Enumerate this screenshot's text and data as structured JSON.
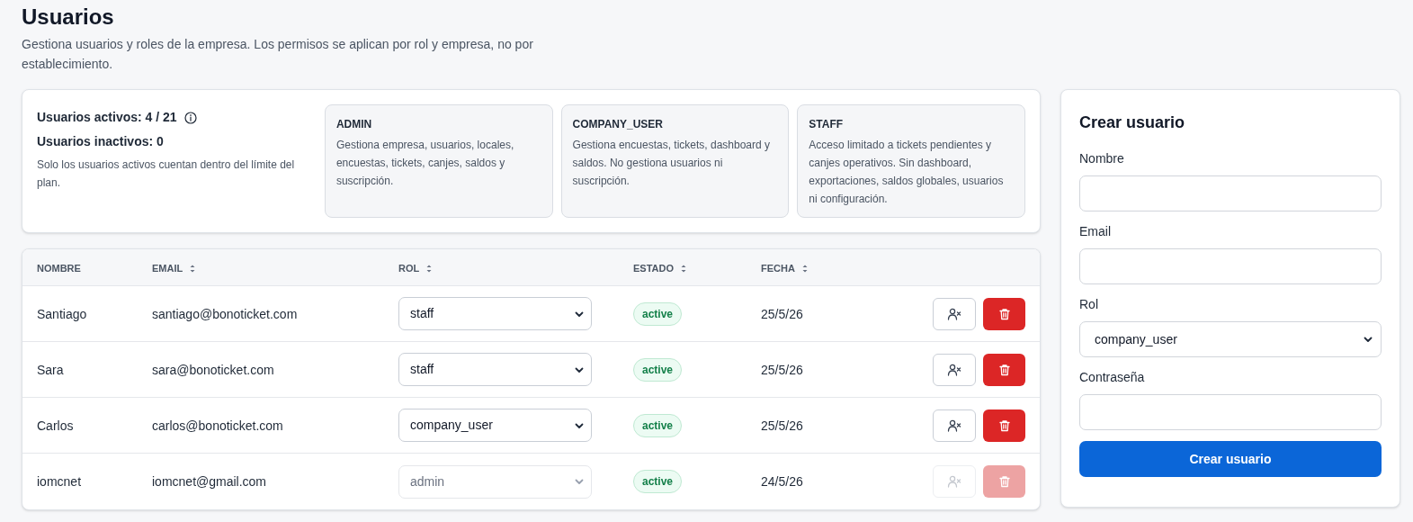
{
  "page": {
    "title": "Usuarios",
    "description": "Gestiona usuarios y roles de la empresa. Los permisos se aplican por rol y empresa, no por establecimiento."
  },
  "summary": {
    "active": "Usuarios activos: 4 / 21",
    "inactive": "Usuarios inactivos: 0",
    "note": "Solo los usuarios activos cuentan dentro del límite del plan."
  },
  "roles": [
    {
      "name": "ADMIN",
      "description": "Gestiona empresa, usuarios, locales, encuestas, tickets, canjes, saldos y suscripción."
    },
    {
      "name": "COMPANY_USER",
      "description": "Gestiona encuestas, tickets, dashboard y saldos. No gestiona usuarios ni suscripción."
    },
    {
      "name": "STAFF",
      "description": "Acceso limitado a tickets pendientes y canjes operativos. Sin dashboard, exportaciones, saldos globales, usuarios ni configuración."
    }
  ],
  "table": {
    "columns": [
      {
        "label": "NOMBRE",
        "sortable": false
      },
      {
        "label": "EMAIL",
        "sortable": true
      },
      {
        "label": "ROL",
        "sortable": true
      },
      {
        "label": "ESTADO",
        "sortable": true
      },
      {
        "label": "FECHA",
        "sortable": true
      }
    ],
    "rows": [
      {
        "name": "Santiago",
        "email": "santiago@bonoticket.com",
        "role": "staff",
        "status": "active",
        "date": "25/5/26",
        "disabled": false
      },
      {
        "name": "Sara",
        "email": "sara@bonoticket.com",
        "role": "staff",
        "status": "active",
        "date": "25/5/26",
        "disabled": false
      },
      {
        "name": "Carlos",
        "email": "carlos@bonoticket.com",
        "role": "company_user",
        "status": "active",
        "date": "25/5/26",
        "disabled": false
      },
      {
        "name": "iomcnet",
        "email": "iomcnet@gmail.com",
        "role": "admin",
        "status": "active",
        "date": "24/5/26",
        "disabled": true
      }
    ]
  },
  "create_form": {
    "title": "Crear usuario",
    "fields": [
      {
        "kind": "text",
        "label": "Nombre"
      },
      {
        "kind": "text",
        "label": "Email"
      },
      {
        "kind": "select",
        "label": "Rol",
        "value": "company_user"
      },
      {
        "kind": "text",
        "label": "Contraseña"
      }
    ],
    "submit": "Crear usuario"
  }
}
